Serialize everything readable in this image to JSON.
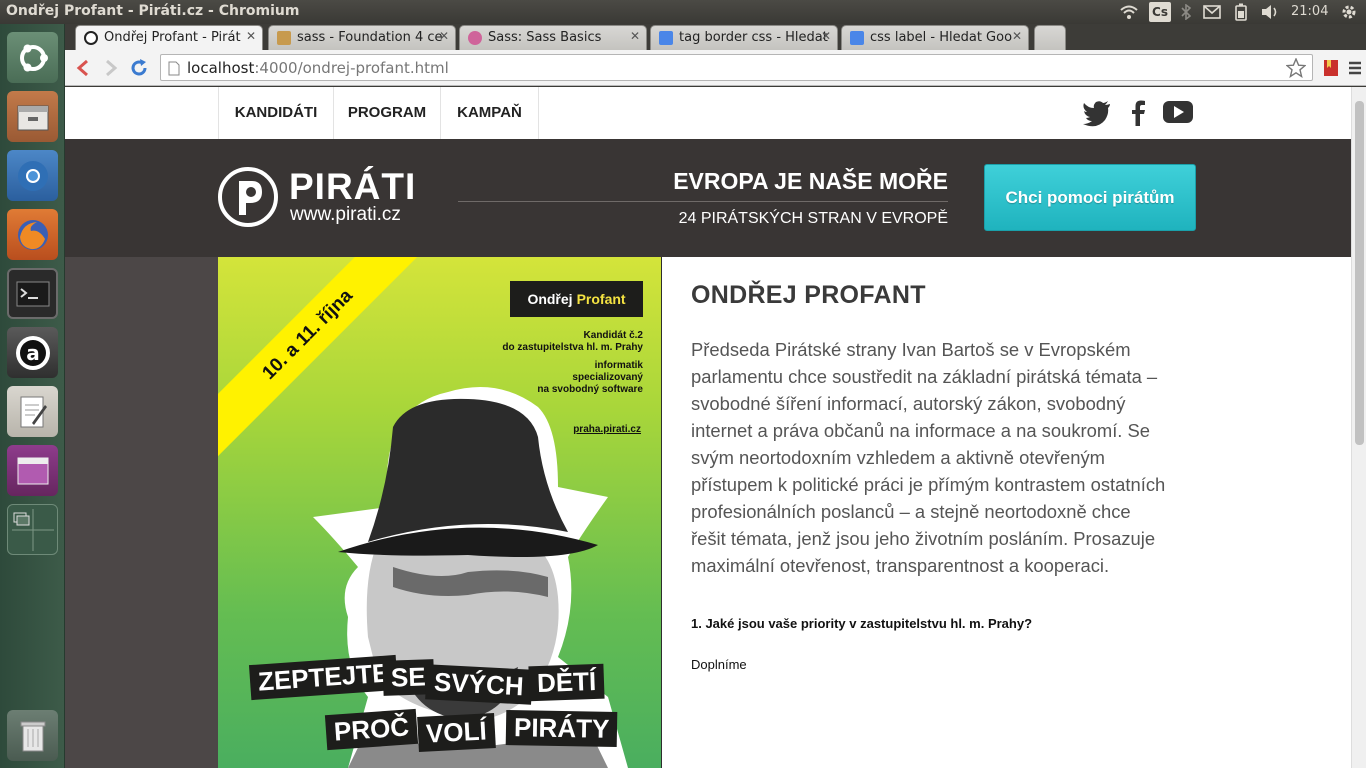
{
  "top_panel": {
    "window_title": "Ondřej Profant - Piráti.cz - Chromium",
    "keyboard_indicator": "Cs",
    "clock": "21:04"
  },
  "launcher": {
    "items": [
      "ubuntu-dash",
      "files",
      "chromium",
      "firefox",
      "terminal",
      "amarok",
      "text-editor",
      "window-app",
      "workspace-switcher",
      "trash"
    ]
  },
  "browser": {
    "tabs": [
      {
        "label": "Ondřej Profant - Pirát",
        "active": true
      },
      {
        "label": "sass - Foundation 4 ce",
        "active": false
      },
      {
        "label": "Sass: Sass Basics",
        "active": false
      },
      {
        "label": "tag border css - Hledat",
        "active": false
      },
      {
        "label": "css label - Hledat Goo",
        "active": false
      }
    ],
    "url_host": "localhost",
    "url_rest": ":4000/ondrej-profant.html"
  },
  "site": {
    "nav": [
      "KANDIDÁTI",
      "PROGRAM",
      "KAMPAŇ"
    ],
    "social": [
      "twitter-icon",
      "facebook-icon",
      "youtube-icon"
    ],
    "logo_name": "PIRÁTI",
    "logo_url": "www.pirati.cz",
    "slogan_main": "EVROPA JE NAŠE MOŘE",
    "slogan_sub": "24 PIRÁTSKÝCH STRAN V EVROPĚ",
    "cta_label": "Chci pomoci pirátům",
    "accent_color": "#29c0ca",
    "header_color": "#393534"
  },
  "poster": {
    "date": "10. a 11. října",
    "name_first": "Ondřej",
    "name_last": "Profant",
    "candidate_line1": "Kandidát č.2",
    "candidate_line2": "do zastupitelstva hl. m. Prahy",
    "role_line1": "informatik",
    "role_line2": "specializovaný",
    "role_line3": "na svobodný software",
    "link": "praha.pirati.cz",
    "slogan_words": [
      "ZEPTEJTE",
      "SE",
      "SVÝCH",
      "DĚTÍ",
      "PROČ",
      "VOLÍ",
      "PIRÁTY"
    ]
  },
  "content": {
    "name": "ONDŘEJ PROFANT",
    "bio": "Předseda Pirátské strany Ivan Bartoš se v Evropském parlamentu chce soustředit na základní pirátská témata – svobodné šíření informací, autorský zákon, svobodný internet a práva občanů na informace a na soukromí. Se svým neortodoxním vzhledem a aktivně otevřeným přístupem k politické práci je přímým kontrastem ostatních profesionálních poslanců – a stejně neortodoxně chce řešit témata, jenž jsou jeho životním posláním. Prosazuje maximální otevřenost, transparentnost a kooperaci.",
    "question": "1. Jaké jsou vaše priority v zastupitelstvu hl. m. Prahy?",
    "answer": "Doplníme"
  }
}
